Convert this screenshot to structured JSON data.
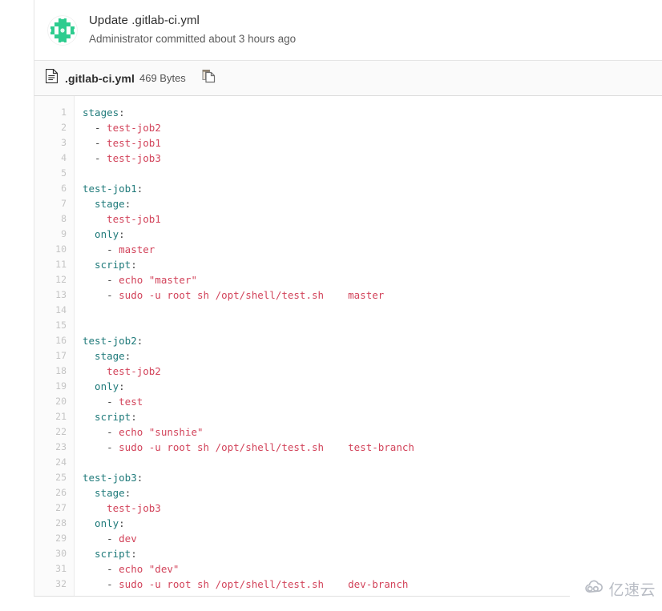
{
  "commit": {
    "title": "Update .gitlab-ci.yml",
    "meta": "Administrator committed about 3 hours ago",
    "avatar_icon": "identicon-avatar",
    "avatar_color": "#2ecc8f"
  },
  "file": {
    "icon": "file-document-icon",
    "name": ".gitlab-ci.yml",
    "size": "469 Bytes",
    "copy_icon": "copy-to-clipboard-icon"
  },
  "code": {
    "language": "yaml",
    "line_count": 32,
    "line_numbers": [
      1,
      2,
      3,
      4,
      5,
      6,
      7,
      8,
      9,
      10,
      11,
      12,
      13,
      14,
      15,
      16,
      17,
      18,
      19,
      20,
      21,
      22,
      23,
      24,
      25,
      26,
      27,
      28,
      29,
      30,
      31,
      32
    ],
    "lines": [
      "stages:",
      "  - test-job2",
      "  - test-job1",
      "  - test-job3",
      "",
      "test-job1:",
      "  stage:",
      "    test-job1",
      "  only:",
      "    - master",
      "  script:",
      "    - echo \"master\"",
      "    - sudo -u root sh /opt/shell/test.sh    master",
      "",
      "",
      "test-job2:",
      "  stage:",
      "    test-job2",
      "  only:",
      "    - test",
      "  script:",
      "    - echo \"sunshie\"",
      "    - sudo -u root sh /opt/shell/test.sh    test-branch",
      "",
      "test-job3:",
      "  stage:",
      "    test-job3",
      "  only:",
      "    - dev",
      "  script:",
      "    - echo \"dev\"",
      "    - sudo -u root sh /opt/shell/test.sh    dev-branch"
    ],
    "tokens": [
      [
        [
          "stages",
          "key"
        ],
        [
          ":",
          "punc"
        ]
      ],
      [
        [
          "  - ",
          "punc"
        ],
        [
          "test-job2",
          "val"
        ]
      ],
      [
        [
          "  - ",
          "punc"
        ],
        [
          "test-job1",
          "val"
        ]
      ],
      [
        [
          "  - ",
          "punc"
        ],
        [
          "test-job3",
          "val"
        ]
      ],
      [],
      [
        [
          "test-job1",
          "key"
        ],
        [
          ":",
          "punc"
        ]
      ],
      [
        [
          "  stage",
          "key"
        ],
        [
          ":",
          "punc"
        ]
      ],
      [
        [
          "    test-job1",
          "val"
        ]
      ],
      [
        [
          "  only",
          "key"
        ],
        [
          ":",
          "punc"
        ]
      ],
      [
        [
          "    - ",
          "punc"
        ],
        [
          "master",
          "val"
        ]
      ],
      [
        [
          "  script",
          "key"
        ],
        [
          ":",
          "punc"
        ]
      ],
      [
        [
          "    - ",
          "punc"
        ],
        [
          "echo \"master\"",
          "str"
        ]
      ],
      [
        [
          "    - ",
          "punc"
        ],
        [
          "sudo -u root sh /opt/shell/test.sh    master",
          "str"
        ]
      ],
      [],
      [],
      [
        [
          "test-job2",
          "key"
        ],
        [
          ":",
          "punc"
        ]
      ],
      [
        [
          "  stage",
          "key"
        ],
        [
          ":",
          "punc"
        ]
      ],
      [
        [
          "    test-job2",
          "val"
        ]
      ],
      [
        [
          "  only",
          "key"
        ],
        [
          ":",
          "punc"
        ]
      ],
      [
        [
          "    - ",
          "punc"
        ],
        [
          "test",
          "val"
        ]
      ],
      [
        [
          "  script",
          "key"
        ],
        [
          ":",
          "punc"
        ]
      ],
      [
        [
          "    - ",
          "punc"
        ],
        [
          "echo \"sunshie\"",
          "str"
        ]
      ],
      [
        [
          "    - ",
          "punc"
        ],
        [
          "sudo -u root sh /opt/shell/test.sh    test-branch",
          "str"
        ]
      ],
      [],
      [
        [
          "test-job3",
          "key"
        ],
        [
          ":",
          "punc"
        ]
      ],
      [
        [
          "  stage",
          "key"
        ],
        [
          ":",
          "punc"
        ]
      ],
      [
        [
          "    test-job3",
          "val"
        ]
      ],
      [
        [
          "  only",
          "key"
        ],
        [
          ":",
          "punc"
        ]
      ],
      [
        [
          "    - ",
          "punc"
        ],
        [
          "dev",
          "val"
        ]
      ],
      [
        [
          "  script",
          "key"
        ],
        [
          ":",
          "punc"
        ]
      ],
      [
        [
          "    - ",
          "punc"
        ],
        [
          "echo \"dev\"",
          "str"
        ]
      ],
      [
        [
          "    - ",
          "punc"
        ],
        [
          "sudo -u root sh /opt/shell/test.sh    dev-branch",
          "str"
        ]
      ]
    ],
    "colors": {
      "key": "#1f7a7a",
      "value": "#d2435a",
      "string": "#d2435a",
      "punctuation": "#444444",
      "line_number": "#c4c4c4"
    }
  },
  "watermark": {
    "icon": "cloud-logo-icon",
    "text": "亿速云",
    "color": "#a9aeb8"
  }
}
